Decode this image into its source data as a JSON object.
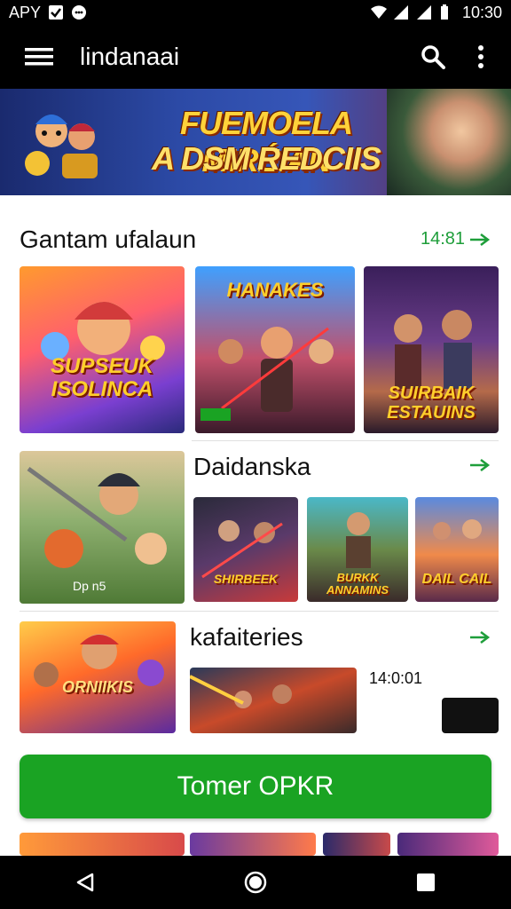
{
  "status_bar": {
    "left_text": "APY",
    "time": "10:30"
  },
  "app_bar": {
    "title": "lindanaai"
  },
  "banner": {
    "line1": "FUEMOELA MIRÉIAN",
    "line2": "A DSM REDCIIS"
  },
  "section1": {
    "title": "Gantam ufalaun",
    "more": "14:81",
    "cards": [
      {
        "caption": "SUPSEUK ISOLINCA"
      },
      {
        "caption": "HANAKES"
      },
      {
        "caption": "SUIRBAIK ESTAUINS"
      }
    ]
  },
  "section2": {
    "title": "Daidanska",
    "featured_caption": "Dp n5",
    "cards": [
      {
        "caption": "SHIRBEEK"
      },
      {
        "caption": "BURKK ANNAMINS"
      },
      {
        "caption": "DAIL CAIL"
      }
    ]
  },
  "section3": {
    "title": "kafaiteries",
    "timestamp": "14:0:01",
    "featured_caption": "ORNIIKIS"
  },
  "cta": {
    "label": "Tomer OPKR"
  },
  "colors": {
    "accent": "#1aa323",
    "link": "#1e9e3a",
    "bar": "#000000"
  }
}
